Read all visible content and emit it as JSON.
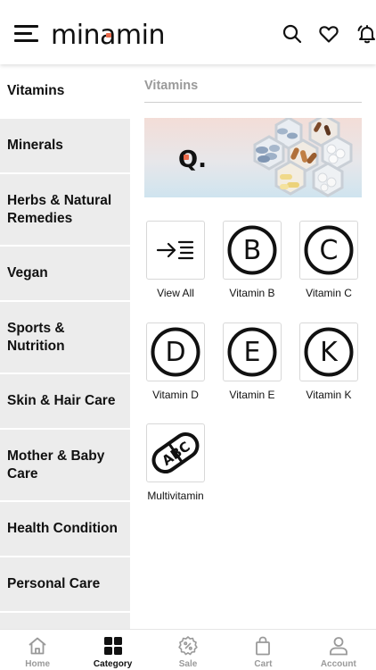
{
  "header": {
    "logo_text": "minamin",
    "menu_icon": "hamburger-menu-icon",
    "icons": [
      "search-icon",
      "heart-icon",
      "bell-icon"
    ]
  },
  "sidebar": {
    "items": [
      {
        "label": "Vitamins",
        "active": true
      },
      {
        "label": "Minerals"
      },
      {
        "label": "Herbs & Natural Remedies"
      },
      {
        "label": "Vegan"
      },
      {
        "label": "Sports & Nutrition"
      },
      {
        "label": "Skin & Hair Care"
      },
      {
        "label": "Mother & Baby Care"
      },
      {
        "label": "Health Condition"
      },
      {
        "label": "Personal Care"
      }
    ]
  },
  "main": {
    "title": "Vitamins",
    "banner_brand": "Q.",
    "tiles": [
      {
        "label": "View All",
        "icon": "view-all-icon"
      },
      {
        "label": "Vitamin B",
        "icon": "vitamin-b-icon",
        "letter": "B"
      },
      {
        "label": "Vitamin C",
        "icon": "vitamin-c-icon",
        "letter": "C"
      },
      {
        "label": "Vitamin D",
        "icon": "vitamin-d-icon",
        "letter": "D"
      },
      {
        "label": "Vitamin E",
        "icon": "vitamin-e-icon",
        "letter": "E"
      },
      {
        "label": "Vitamin K",
        "icon": "vitamin-k-icon",
        "letter": "K"
      },
      {
        "label": "Multivitamin",
        "icon": "multivitamin-capsule-icon",
        "letter": "ABC"
      }
    ]
  },
  "bottom_nav": {
    "items": [
      {
        "label": "Home",
        "icon": "home-icon"
      },
      {
        "label": "Category",
        "icon": "category-grid-icon",
        "active": true
      },
      {
        "label": "Sale",
        "icon": "sale-percent-icon"
      },
      {
        "label": "Cart",
        "icon": "cart-bag-icon"
      },
      {
        "label": "Account",
        "icon": "account-icon"
      }
    ]
  },
  "colors": {
    "sidebar_bg": "#ececec",
    "muted_text": "#9a9a9a",
    "logo_accent": "#e8694a",
    "text": "#111111"
  }
}
